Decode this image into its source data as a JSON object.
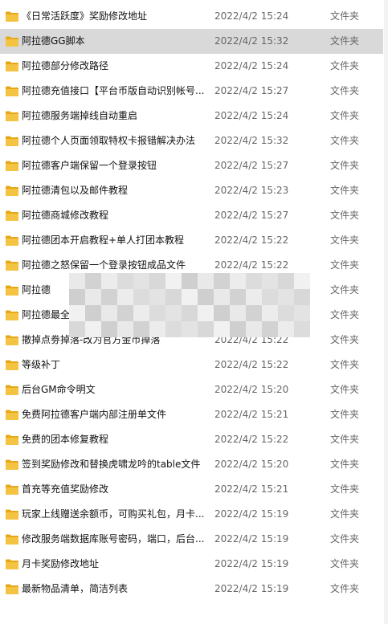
{
  "rows": [
    {
      "name": "《日常活跃度》奖励修改地址",
      "date": "2022/4/2 15:24",
      "type": "文件夹"
    },
    {
      "name": "阿拉德GG脚本",
      "date": "2022/4/2 15:32",
      "type": "文件夹",
      "selected": true
    },
    {
      "name": "阿拉德部分修改路径",
      "date": "2022/4/2 15:24",
      "type": "文件夹"
    },
    {
      "name": "阿拉德充值接口【平台币版自动识别帐号...",
      "date": "2022/4/2 15:27",
      "type": "文件夹"
    },
    {
      "name": "阿拉德服务端掉线自动重启",
      "date": "2022/4/2 15:24",
      "type": "文件夹"
    },
    {
      "name": "阿拉德个人页面领取特权卡报错解决办法",
      "date": "2022/4/2 15:32",
      "type": "文件夹"
    },
    {
      "name": "阿拉德客户端保留一个登录按钮",
      "date": "2022/4/2 15:27",
      "type": "文件夹"
    },
    {
      "name": "阿拉德清包以及邮件教程",
      "date": "2022/4/2 15:23",
      "type": "文件夹"
    },
    {
      "name": "阿拉德商城修改教程",
      "date": "2022/4/2 15:27",
      "type": "文件夹"
    },
    {
      "name": "阿拉德团本开启教程+单人打团本教程",
      "date": "2022/4/2 15:22",
      "type": "文件夹"
    },
    {
      "name": "阿拉德之怒保留一个登录按钮成品文件",
      "date": "2022/4/2 15:22",
      "type": "文件夹"
    },
    {
      "name": "阿拉德",
      "date": "",
      "type": "文件夹"
    },
    {
      "name": "阿拉德最全",
      "date": "",
      "type": "文件夹"
    },
    {
      "name": "撤掉点劵掉落-改为官方金币掉落",
      "date": "2022/4/2 15:22",
      "type": "文件夹"
    },
    {
      "name": "等级补丁",
      "date": "2022/4/2 15:22",
      "type": "文件夹"
    },
    {
      "name": "后台GM命令明文",
      "date": "2022/4/2 15:20",
      "type": "文件夹"
    },
    {
      "name": "免费阿拉德客户端内部注册单文件",
      "date": "2022/4/2 15:21",
      "type": "文件夹"
    },
    {
      "name": "免费的团本修复教程",
      "date": "2022/4/2 15:22",
      "type": "文件夹"
    },
    {
      "name": "签到奖励修改和替换虎啸龙吟的table文件",
      "date": "2022/4/2 15:20",
      "type": "文件夹"
    },
    {
      "name": "首充等充值奖励修改",
      "date": "2022/4/2 15:21",
      "type": "文件夹"
    },
    {
      "name": "玩家上线赠送余额币，可购买礼包，月卡...",
      "date": "2022/4/2 15:19",
      "type": "文件夹"
    },
    {
      "name": "修改服务端数据库账号密码，端口，后台...",
      "date": "2022/4/2 15:19",
      "type": "文件夹"
    },
    {
      "name": "月卡奖励修改地址",
      "date": "2022/4/2 15:19",
      "type": "文件夹"
    },
    {
      "name": "最新物品清单，简洁列表",
      "date": "2022/4/2 15:19",
      "type": "文件夹"
    }
  ],
  "colors": {
    "folder_body": "#f5c342",
    "folder_tab": "#e6a817",
    "selected_bg": "#d9d9d9",
    "secondary_text": "#666666"
  },
  "icons": {
    "folder": "folder-icon"
  }
}
